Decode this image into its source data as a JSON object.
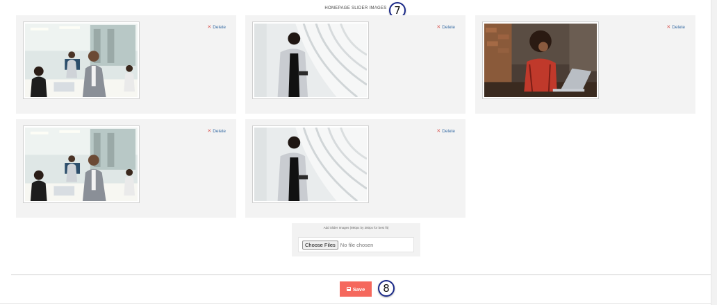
{
  "section": {
    "title": "HOMEPAGE SLIDER IMAGES"
  },
  "steps": {
    "slider_step": "7",
    "save_step": "8"
  },
  "slider_images": [
    {
      "photo": "office-meeting",
      "delete_label": "Delete"
    },
    {
      "photo": "woman-with-tablet",
      "delete_label": "Delete"
    },
    {
      "photo": "woman-with-laptop",
      "delete_label": "Delete"
    },
    {
      "photo": "office-meeting",
      "delete_label": "Delete"
    },
    {
      "photo": "woman-with-tablet",
      "delete_label": "Delete"
    }
  ],
  "upload": {
    "hint": "Add Slider Images (890px by 380px for best fit)",
    "choose_label": "Choose Files",
    "no_file_label": "No file chosen"
  },
  "save": {
    "label": "Save",
    "color": "#f5685d"
  },
  "icons": {
    "delete": "x-icon",
    "save": "floppy-disk-icon"
  },
  "colors": {
    "link": "#3a6ea5",
    "delete_x": "#d9534f",
    "badge_border": "#1b2a8a"
  }
}
